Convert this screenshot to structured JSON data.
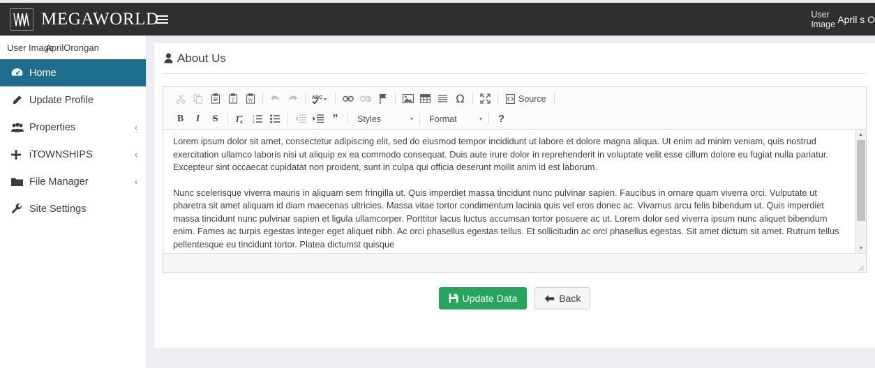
{
  "header": {
    "brand_name": "MEGAWORLD",
    "logo_icon": "megaworld-w-monogram",
    "menu_toggle_icon": "hamburger-icon",
    "user_image_alt": "User Image",
    "user_name": "April s O"
  },
  "sidebar": {
    "user_image_alt": "User Image",
    "user_name": "AprilOrongan",
    "items": [
      {
        "label": "Home",
        "icon": "dashboard-icon",
        "active": true,
        "caret": ""
      },
      {
        "label": "Update Profile",
        "icon": "pencil-icon",
        "active": false,
        "caret": ""
      },
      {
        "label": "Properties",
        "icon": "users-icon",
        "active": false,
        "caret": "‹"
      },
      {
        "label": "iTOWNSHIPS",
        "icon": "plus-icon",
        "active": false,
        "caret": "‹"
      },
      {
        "label": "File Manager",
        "icon": "folder-icon",
        "active": false,
        "caret": "‹"
      },
      {
        "label": "Site Settings",
        "icon": "wrench-icon",
        "active": false,
        "caret": ""
      }
    ]
  },
  "page": {
    "title": "About Us",
    "title_icon": "user-icon"
  },
  "editor": {
    "toolbar_row1": [
      {
        "name": "cut-icon",
        "type": "icon",
        "disabled": true
      },
      {
        "name": "copy-icon",
        "type": "icon",
        "disabled": true
      },
      {
        "name": "paste-icon",
        "type": "icon",
        "disabled": false
      },
      {
        "name": "paste-as-text-icon",
        "type": "icon",
        "disabled": false
      },
      {
        "name": "paste-from-word-icon",
        "type": "icon",
        "disabled": false
      },
      {
        "name": "separator",
        "type": "sep"
      },
      {
        "name": "undo-icon",
        "type": "icon",
        "disabled": true
      },
      {
        "name": "redo-icon",
        "type": "icon",
        "disabled": true
      },
      {
        "name": "separator",
        "type": "sep"
      },
      {
        "name": "spellcheck-icon",
        "type": "icon",
        "disabled": false
      },
      {
        "name": "separator",
        "type": "sep"
      },
      {
        "name": "link-icon",
        "type": "icon",
        "disabled": false
      },
      {
        "name": "unlink-icon",
        "type": "icon",
        "disabled": true
      },
      {
        "name": "anchor-flag-icon",
        "type": "icon",
        "disabled": false
      },
      {
        "name": "separator",
        "type": "sep"
      },
      {
        "name": "image-icon",
        "type": "icon",
        "disabled": false
      },
      {
        "name": "table-icon",
        "type": "icon",
        "disabled": false
      },
      {
        "name": "horizontal-rule-icon",
        "type": "icon",
        "disabled": false
      },
      {
        "name": "special-character-icon",
        "type": "icon",
        "disabled": false
      },
      {
        "name": "separator",
        "type": "sep"
      },
      {
        "name": "maximize-icon",
        "type": "icon",
        "disabled": false
      },
      {
        "name": "separator",
        "type": "sep"
      }
    ],
    "source_label": "Source",
    "source_icon": "source-code-icon",
    "toolbar_row2": [
      {
        "name": "bold-icon",
        "type": "icon",
        "disabled": false
      },
      {
        "name": "italic-icon",
        "type": "icon",
        "disabled": false
      },
      {
        "name": "strikethrough-icon",
        "type": "icon",
        "disabled": false
      },
      {
        "name": "separator",
        "type": "sep"
      },
      {
        "name": "remove-format-icon",
        "type": "icon",
        "disabled": false
      },
      {
        "name": "numbered-list-icon",
        "type": "icon",
        "disabled": false
      },
      {
        "name": "bulleted-list-icon",
        "type": "icon",
        "disabled": false
      },
      {
        "name": "separator",
        "type": "sep"
      },
      {
        "name": "outdent-icon",
        "type": "icon",
        "disabled": true
      },
      {
        "name": "indent-icon",
        "type": "icon",
        "disabled": false
      },
      {
        "name": "blockquote-icon",
        "type": "icon",
        "disabled": false
      },
      {
        "name": "separator",
        "type": "sep"
      }
    ],
    "styles_label": "Styles",
    "format_label": "Format",
    "dropdown_arrow": "▾",
    "help_label": "?",
    "paragraphs": [
      "Lorem ipsum dolor sit amet, consectetur adipiscing elit, sed do eiusmod tempor incididunt ut labore et dolore magna aliqua. Ut enim ad minim veniam, quis nostrud exercitation ullamco laboris nisi ut aliquip ex ea commodo consequat. Duis aute irure dolor in reprehenderit in voluptate velit esse cillum dolore eu fugiat nulla pariatur. Excepteur sint occaecat cupidatat non proident, sunt in culpa qui officia deserunt mollit anim id est laborum.",
      "Nunc scelerisque viverra mauris in aliquam sem fringilla ut. Quis imperdiet massa tincidunt nunc pulvinar sapien. Faucibus in ornare quam viverra orci. Vulputate ut pharetra sit amet aliquam id diam maecenas ultricies. Massa vitae tortor condimentum lacinia quis vel eros donec ac. Vivamus arcu felis bibendum ut. Quis imperdiet massa tincidunt nunc pulvinar sapien et ligula ullamcorper. Porttitor lacus luctus accumsan tortor posuere ac ut. Lorem dolor sed viverra ipsum nunc aliquet bibendum enim. Fames ac turpis egestas integer eget aliquet nibh. Ac orci phasellus egestas tellus. Et sollicitudin ac orci phasellus egestas. Sit amet dictum sit amet. Rutrum tellus pellentesque eu tincidunt tortor. Platea dictumst quisque"
    ],
    "scroll_up_icon": "▲",
    "scroll_down_icon": "▼",
    "resize-grip": "resize-grip-icon"
  },
  "actions": {
    "update_label": "Update Data",
    "update_icon": "save-floppy-icon",
    "back_label": "Back",
    "back_icon": "arrow-left-icon"
  },
  "colors": {
    "header_bg": "#2f2f2f",
    "sidebar_active": "#1d6e8c",
    "body_bg": "#eceef3",
    "primary_button": "#24a75c"
  }
}
